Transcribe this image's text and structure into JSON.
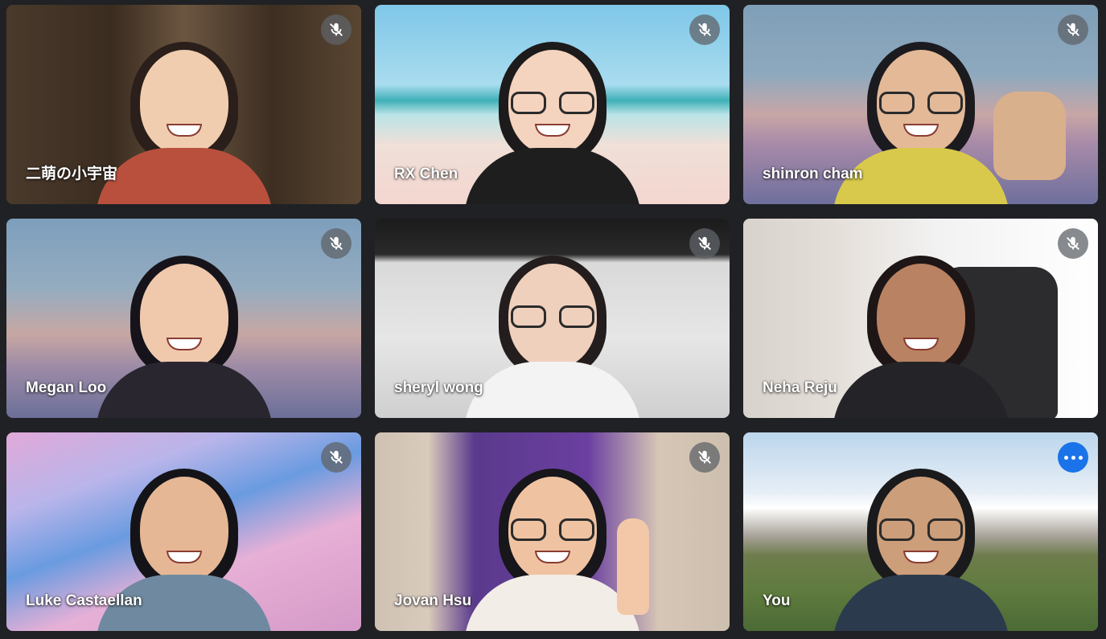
{
  "meeting": {
    "participants": [
      {
        "name": "二萌の小宇宙",
        "muted": true,
        "self": false
      },
      {
        "name": "RX Chen",
        "muted": true,
        "self": false
      },
      {
        "name": "shinron cham",
        "muted": true,
        "self": false
      },
      {
        "name": "Megan Loo",
        "muted": true,
        "self": false
      },
      {
        "name": "sheryl wong",
        "muted": true,
        "self": false
      },
      {
        "name": "Neha Reju",
        "muted": true,
        "self": false
      },
      {
        "name": "Luke Castaellan",
        "muted": true,
        "self": false
      },
      {
        "name": "Jovan Hsu",
        "muted": true,
        "self": false
      },
      {
        "name": "You",
        "muted": false,
        "self": true
      }
    ]
  },
  "icons": {
    "mute": "mic-off-icon",
    "more": "more-options-icon"
  },
  "colors": {
    "page_background": "#202124",
    "mute_badge": "#5f6368",
    "more_button": "#1a73e8",
    "active_border": "#8ab4f8"
  }
}
